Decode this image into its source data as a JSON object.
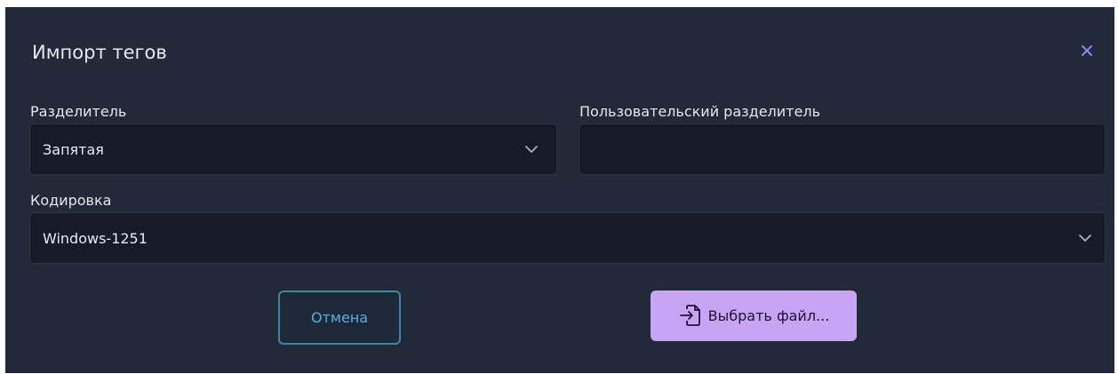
{
  "dialog": {
    "title": "Импорт тегов",
    "close_icon": "close-icon"
  },
  "separator": {
    "label": "Разделитель",
    "selected": "Запятая"
  },
  "custom_separator": {
    "label": "Пользовательский разделитель",
    "value": ""
  },
  "encoding": {
    "label": "Кодировка",
    "selected": "Windows-1251"
  },
  "actions": {
    "cancel_label": "Отмена",
    "choose_file_label": "Выбрать файл...",
    "choose_file_icon": "file-import-icon"
  },
  "colors": {
    "dialog_bg": "#222938",
    "field_bg": "#151b27",
    "accent_close": "#9b7ff0",
    "cancel_border": "#3a87a8",
    "cancel_text": "#4fb3e0",
    "primary_bg": "#c8a4f4"
  }
}
